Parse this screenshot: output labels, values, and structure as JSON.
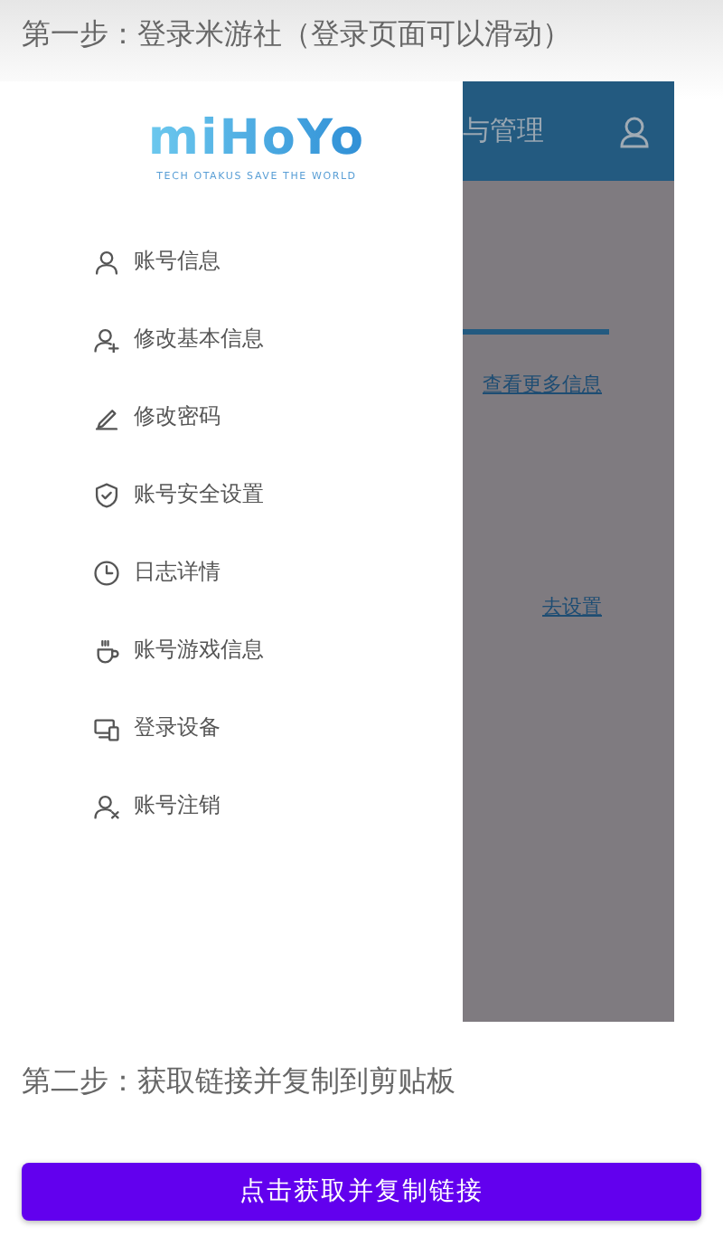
{
  "steps": [
    {
      "title": "第一步：登录米游社（登录页面可以滑动）"
    },
    {
      "title": "第二步：获取链接并复制到剪贴板"
    }
  ],
  "drawer": {
    "logo": "miHoYo",
    "tagline": "TECH OTAKUS SAVE THE WORLD",
    "items": [
      {
        "label": "账号信息",
        "kind": "person"
      },
      {
        "label": "修改基本信息",
        "kind": "person-add"
      },
      {
        "label": "修改密码",
        "kind": "pencil"
      },
      {
        "label": "账号安全设置",
        "kind": "shield"
      },
      {
        "label": "日志详情",
        "kind": "clock"
      },
      {
        "label": "账号游戏信息",
        "kind": "cup"
      },
      {
        "label": "登录设备",
        "kind": "devices"
      },
      {
        "label": "账号注销",
        "kind": "person-remove"
      }
    ]
  },
  "background_page": {
    "header_title": "与管理",
    "links": [
      "查看更多信息",
      "去设置"
    ]
  },
  "button": {
    "label": "点击获取并复制链接"
  }
}
